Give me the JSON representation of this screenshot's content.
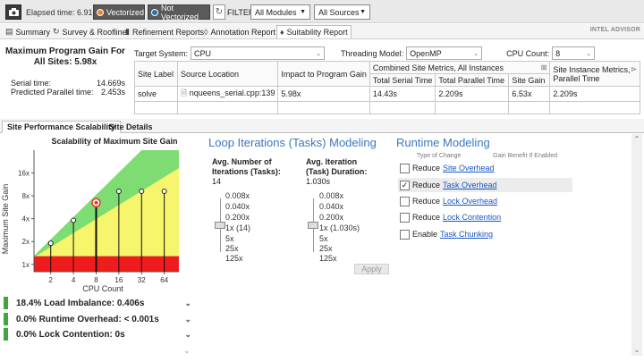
{
  "toolbar": {
    "camera_icon": "camera-icon",
    "elapsed": "Elapsed time: 6.91s",
    "vectorized": "Vectorized",
    "not_vectorized": "Not Vectorized",
    "filter_label": "FILTER:",
    "modules": "All Modules",
    "sources": "All Sources"
  },
  "tabs": [
    {
      "label": "Summary",
      "icon": "summary-icon"
    },
    {
      "label": "Survey & Roofline",
      "icon": "survey-icon"
    },
    {
      "label": "Refinement Reports",
      "icon": "refinement-icon"
    },
    {
      "label": "Annotation Report",
      "icon": "annotation-icon"
    },
    {
      "label": "Suitability Report",
      "icon": "suitability-icon"
    }
  ],
  "brand": "INTEL ADVISOR",
  "summary": {
    "title": "Maximum Program Gain For All Sites: 5.98x",
    "serial_label": "Serial time:",
    "serial_value": "14.669s",
    "parallel_label": "Predicted Parallel time:",
    "parallel_value": "2.453s"
  },
  "settings": {
    "target_label": "Target System:",
    "target_value": "CPU",
    "threading_label": "Threading Model:",
    "threading_value": "OpenMP",
    "cpu_label": "CPU Count:",
    "cpu_value": "8"
  },
  "site_table": {
    "headers": {
      "site_label": "Site Label",
      "source_location": "Source Location",
      "impact": "Impact to Program Gain",
      "combined": "Combined Site Metrics, All Instances",
      "instance": "Site Instance Metrics, Parallel Time",
      "total_serial": "Total Serial Time",
      "total_parallel": "Total Parallel Time",
      "site_gain": "Site Gain"
    },
    "row": {
      "site_label": "solve",
      "source_location": "nqueens_serial.cpp:139",
      "impact": "5.98x",
      "total_serial": "14.43s",
      "total_parallel": "2.209s",
      "site_gain": "6.53x",
      "instance_parallel": "2.209s"
    }
  },
  "section_tabs": {
    "scalability": "Site Performance Scalability",
    "details": "Site Details"
  },
  "chart_data": {
    "type": "scatter",
    "title": "Scalability of Maximum Site Gain",
    "xlabel": "CPU Count",
    "ylabel": "Maximum Site Gain",
    "x_ticks": [
      "2",
      "4",
      "8",
      "16",
      "32",
      "64"
    ],
    "y_ticks": [
      "1x",
      "2x",
      "4x",
      "8x",
      "16x"
    ],
    "scale": "log2",
    "xlim": [
      1.2,
      100
    ],
    "ylim": [
      0.8,
      32
    ],
    "points": [
      {
        "x": 2,
        "y": 1.9
      },
      {
        "x": 4,
        "y": 3.8
      },
      {
        "x": 8,
        "y": 6.5,
        "selected": true
      },
      {
        "x": 16,
        "y": 9.2
      },
      {
        "x": 32,
        "y": 9.2
      },
      {
        "x": 64,
        "y": 9.2
      }
    ],
    "colors": {
      "green": "#7ddc72",
      "yellow": "#f6f56c",
      "red": "#ee1c1c",
      "selected": "#e6322a"
    }
  },
  "metrics": [
    {
      "label": "18.4% Load Imbalance: 0.406s",
      "color": "#3aa83a"
    },
    {
      "label": "0.0% Runtime Overhead: < 0.001s",
      "color": "#3aa83a"
    },
    {
      "label": "0.0% Lock Contention: 0s",
      "color": "#3aa83a"
    }
  ],
  "loop_modeling": {
    "title": "Loop Iterations (Tasks) Modeling",
    "col1_head": "Avg. Number of Iterations (Tasks):",
    "col1_value": "14",
    "col2_head": "Avg. Iteration (Task) Duration:",
    "col2_value": "1.030s",
    "col1_scale": [
      "0.008x",
      "0.040x",
      "0.200x",
      "1x (14)",
      "5x",
      "25x",
      "125x"
    ],
    "col2_scale": [
      "0.008x",
      "0.040x",
      "0.200x",
      "1x (1.030s)",
      "5x",
      "25x",
      "125x"
    ],
    "apply": "Apply"
  },
  "runtime_modeling": {
    "title": "Runtime Modeling",
    "type_header": "Type of Change",
    "gain_header": "Gain Benefit If Enabled",
    "rows": [
      {
        "prefix": "Reduce",
        "link": "Site Overhead",
        "checked": false
      },
      {
        "prefix": "Reduce",
        "link": "Task Overhead",
        "checked": true
      },
      {
        "prefix": "Reduce",
        "link": "Lock Overhead",
        "checked": false
      },
      {
        "prefix": "Reduce",
        "link": "Lock Contention",
        "checked": false
      },
      {
        "prefix": "Enable",
        "link": "Task Chunking",
        "checked": false
      }
    ]
  }
}
